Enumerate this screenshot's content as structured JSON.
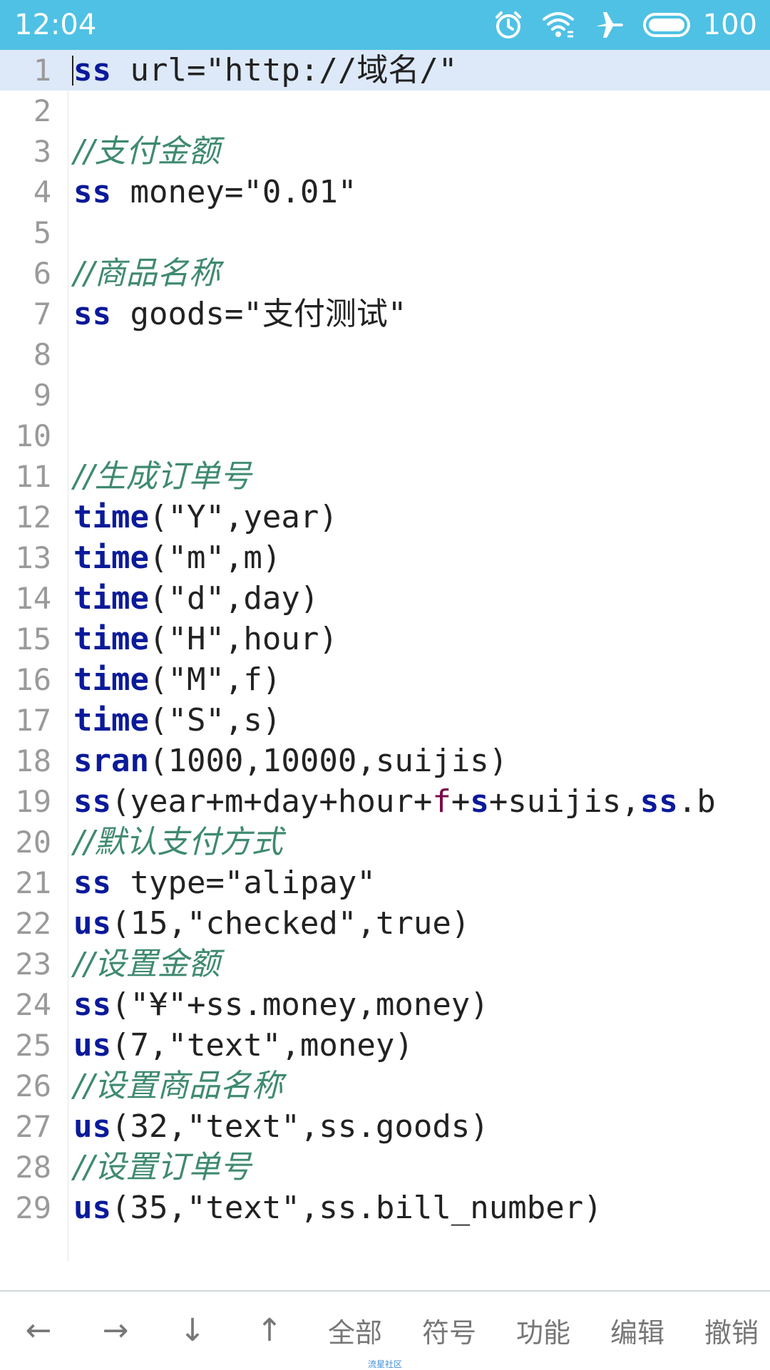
{
  "status_bar": {
    "time": "12:04",
    "battery": "100",
    "icons": [
      "alarm-icon",
      "wifi-icon",
      "airplane-icon",
      "battery-icon"
    ]
  },
  "editor": {
    "lines": [
      {
        "num": "1",
        "tokens": [
          {
            "t": "ss",
            "c": "kw"
          },
          {
            "t": " url=\"http://域名/\"",
            "c": ""
          }
        ]
      },
      {
        "num": "2",
        "tokens": []
      },
      {
        "num": "3",
        "tokens": [
          {
            "t": "//支付金额",
            "c": "cm"
          }
        ]
      },
      {
        "num": "4",
        "tokens": [
          {
            "t": "ss",
            "c": "kw"
          },
          {
            "t": " money=\"0.01\"",
            "c": ""
          }
        ]
      },
      {
        "num": "5",
        "tokens": []
      },
      {
        "num": "6",
        "tokens": [
          {
            "t": "//商品名称",
            "c": "cm"
          }
        ]
      },
      {
        "num": "7",
        "tokens": [
          {
            "t": "ss",
            "c": "kw"
          },
          {
            "t": " goods=\"支付测试\"",
            "c": ""
          }
        ]
      },
      {
        "num": "8",
        "tokens": []
      },
      {
        "num": "9",
        "tokens": []
      },
      {
        "num": "10",
        "tokens": []
      },
      {
        "num": "11",
        "tokens": [
          {
            "t": "//生成订单号",
            "c": "cm"
          }
        ]
      },
      {
        "num": "12",
        "tokens": [
          {
            "t": "time",
            "c": "kw"
          },
          {
            "t": "(\"Y\",year)",
            "c": ""
          }
        ]
      },
      {
        "num": "13",
        "tokens": [
          {
            "t": "time",
            "c": "kw"
          },
          {
            "t": "(\"m\",m)",
            "c": ""
          }
        ]
      },
      {
        "num": "14",
        "tokens": [
          {
            "t": "time",
            "c": "kw"
          },
          {
            "t": "(\"d\",day)",
            "c": ""
          }
        ]
      },
      {
        "num": "15",
        "tokens": [
          {
            "t": "time",
            "c": "kw"
          },
          {
            "t": "(\"H\",hour)",
            "c": ""
          }
        ]
      },
      {
        "num": "16",
        "tokens": [
          {
            "t": "time",
            "c": "kw"
          },
          {
            "t": "(\"M\",f)",
            "c": ""
          }
        ]
      },
      {
        "num": "17",
        "tokens": [
          {
            "t": "time",
            "c": "kw"
          },
          {
            "t": "(\"S\",s)",
            "c": ""
          }
        ]
      },
      {
        "num": "18",
        "tokens": [
          {
            "t": "sran",
            "c": "kw"
          },
          {
            "t": "(1000,10000,suijis)",
            "c": ""
          }
        ]
      },
      {
        "num": "19",
        "tokens": [
          {
            "t": "ss",
            "c": "kw"
          },
          {
            "t": "(year+m+day+hour+",
            "c": ""
          },
          {
            "t": "f",
            "c": "pv"
          },
          {
            "t": "+",
            "c": ""
          },
          {
            "t": "s",
            "c": "kw"
          },
          {
            "t": "+suijis,",
            "c": ""
          },
          {
            "t": "ss",
            "c": "kw"
          },
          {
            "t": ".b",
            "c": ""
          }
        ]
      },
      {
        "num": "20",
        "tokens": [
          {
            "t": "//默认支付方式",
            "c": "cm"
          }
        ]
      },
      {
        "num": "21",
        "tokens": [
          {
            "t": "ss",
            "c": "kw"
          },
          {
            "t": " type=\"alipay\"",
            "c": ""
          }
        ]
      },
      {
        "num": "22",
        "tokens": [
          {
            "t": "us",
            "c": "kw"
          },
          {
            "t": "(15,\"checked\",true)",
            "c": ""
          }
        ]
      },
      {
        "num": "23",
        "tokens": [
          {
            "t": "//设置金额",
            "c": "cm"
          }
        ]
      },
      {
        "num": "24",
        "tokens": [
          {
            "t": "ss",
            "c": "kw"
          },
          {
            "t": "(\"¥\"+ss.money,money)",
            "c": ""
          }
        ]
      },
      {
        "num": "25",
        "tokens": [
          {
            "t": "us",
            "c": "kw"
          },
          {
            "t": "(7,\"text\",money)",
            "c": ""
          }
        ]
      },
      {
        "num": "26",
        "tokens": [
          {
            "t": "//设置商品名称",
            "c": "cm"
          }
        ]
      },
      {
        "num": "27",
        "tokens": [
          {
            "t": "us",
            "c": "kw"
          },
          {
            "t": "(32,\"text\",ss.goods)",
            "c": ""
          }
        ]
      },
      {
        "num": "28",
        "tokens": [
          {
            "t": "//设置订单号",
            "c": "cm"
          }
        ]
      },
      {
        "num": "29",
        "tokens": [
          {
            "t": "us",
            "c": "kw"
          },
          {
            "t": "(35,\"text\",ss.bill_number)",
            "c": ""
          }
        ]
      }
    ]
  },
  "toolbar": {
    "left_arrow": "←",
    "right_arrow": "→",
    "down_arrow": "↓",
    "up_arrow": "↑",
    "all": "全部",
    "symbol": "符号",
    "function": "功能",
    "edit": "编辑",
    "undo": "撤销",
    "watermark": "流星社区"
  },
  "colors": {
    "status_bar": "#4fc1e4",
    "keyword": "#0a1a9a",
    "comment": "#3f8a70",
    "current_line": "#dde9f8"
  }
}
